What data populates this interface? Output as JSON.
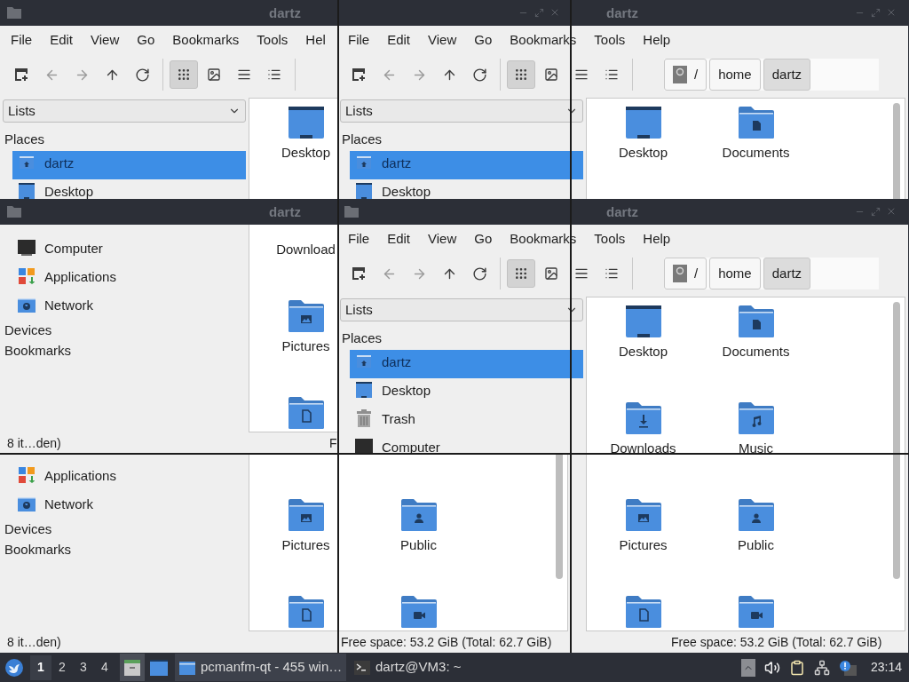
{
  "tiles": [
    {
      "title_bar": {
        "title": "dartz"
      },
      "menu": [
        "File",
        "Edit",
        "View",
        "Go",
        "Bookmarks",
        "Tools",
        "Hel"
      ],
      "toolbar": {
        "view_modes": [
          {
            "selected": true
          },
          {
            "selected": false
          },
          {
            "selected": false
          },
          {
            "selected": false
          }
        ]
      },
      "sidebar": {
        "dropdown": "Lists",
        "places_heading": "Places",
        "places": [
          {
            "kind": "home",
            "label": "dartz",
            "selected": true
          },
          {
            "kind": "desktop",
            "label": "Desktop",
            "selected": false
          }
        ]
      },
      "files": [
        {
          "kind": "desktop",
          "label": "Desktop"
        }
      ]
    },
    {
      "title_bar": {
        "title": "dartz"
      },
      "menu": [
        "File",
        "Edit",
        "View",
        "Go",
        "Bookmarks",
        "Tools",
        "Help"
      ],
      "toolbar": {
        "view_modes": [
          {
            "selected": true
          },
          {
            "selected": false
          },
          {
            "selected": false
          },
          {
            "selected": false
          }
        ]
      },
      "path": [
        {
          "kind": "root",
          "label": "/",
          "selected": false
        },
        {
          "kind": "folder",
          "label": "home",
          "selected": false
        },
        {
          "kind": "folder",
          "label": "dartz",
          "selected": true
        }
      ],
      "sidebar": {
        "dropdown": "Lists",
        "places_heading": "Places",
        "places": [
          {
            "kind": "home",
            "label": "dartz",
            "selected": true
          },
          {
            "kind": "desktop",
            "label": "Desktop",
            "selected": false
          }
        ]
      },
      "files": [
        {
          "kind": "desktop",
          "label": "Desktop"
        },
        {
          "kind": "documents",
          "label": "Documents"
        }
      ]
    },
    {
      "title_bar": {
        "title": "dartz"
      },
      "sidebar": {
        "places": [
          {
            "kind": "computer",
            "label": "Computer",
            "selected": false
          },
          {
            "kind": "applications",
            "label": "Applications",
            "selected": false
          },
          {
            "kind": "network",
            "label": "Network",
            "selected": false
          }
        ],
        "sections": [
          "Devices",
          "Bookmarks"
        ]
      },
      "files": [
        {
          "label": "Download"
        },
        {
          "kind": "pictures",
          "label": "Pictures"
        },
        {
          "kind": "template"
        }
      ],
      "status": {
        "left": "8 it…den)",
        "right": "F"
      }
    },
    {
      "title_bar": {
        "title": "dartz"
      },
      "menu": [
        "File",
        "Edit",
        "View",
        "Go",
        "Bookmarks",
        "Tools",
        "Help"
      ],
      "toolbar": {
        "view_modes": [
          {
            "selected": true
          },
          {
            "selected": false
          },
          {
            "selected": false
          },
          {
            "selected": false
          }
        ]
      },
      "path": [
        {
          "kind": "root",
          "label": "/",
          "selected": false
        },
        {
          "kind": "folder",
          "label": "home",
          "selected": false
        },
        {
          "kind": "folder",
          "label": "dartz",
          "selected": true
        }
      ],
      "sidebar": {
        "dropdown": "Lists",
        "places_heading": "Places",
        "places": [
          {
            "kind": "home",
            "label": "dartz",
            "selected": true
          },
          {
            "kind": "desktop",
            "label": "Desktop",
            "selected": false
          },
          {
            "kind": "trash",
            "label": "Trash",
            "selected": false
          },
          {
            "kind": "computer",
            "label": "Computer",
            "selected": false
          }
        ]
      },
      "files": [
        {
          "kind": "desktop",
          "label": "Desktop"
        },
        {
          "kind": "documents",
          "label": "Documents"
        },
        {
          "kind": "downloads",
          "label": "Downloads"
        },
        {
          "kind": "music",
          "label": "Music"
        }
      ]
    },
    {
      "sidebar": {
        "places": [
          {
            "kind": "applications",
            "label": "Applications",
            "selected": false
          },
          {
            "kind": "network",
            "label": "Network",
            "selected": false
          }
        ],
        "sections": [
          "Devices",
          "Bookmarks"
        ]
      },
      "files": [
        {
          "kind": "pictures",
          "label": "Pictures"
        },
        {
          "kind": "public",
          "label": "Public"
        },
        {
          "kind": "template"
        },
        {
          "kind": "videos"
        }
      ],
      "status": {
        "left": "8 it…den)",
        "right": "Free space: 53.2 GiB (Total: 62.7 GiB)"
      }
    },
    {
      "files": [
        {
          "kind": "pictures",
          "label": "Pictures"
        },
        {
          "kind": "public",
          "label": "Public"
        },
        {
          "kind": "template"
        },
        {
          "kind": "videos"
        }
      ],
      "status": {
        "right": "Free space: 53.2 GiB (Total: 62.7 GiB)"
      }
    }
  ],
  "taskbar": {
    "desktops": [
      {
        "label": "1",
        "selected": true
      },
      {
        "label": "2",
        "selected": false
      },
      {
        "label": "3",
        "selected": false
      },
      {
        "label": "4",
        "selected": false
      }
    ],
    "tasks": [
      {
        "kind": "folder",
        "label": "pcmanfm-qt - 455 win…",
        "selected": true
      },
      {
        "kind": "terminal",
        "label": "dartz@VM3: ~",
        "selected": false
      }
    ],
    "clock": "23:14"
  }
}
